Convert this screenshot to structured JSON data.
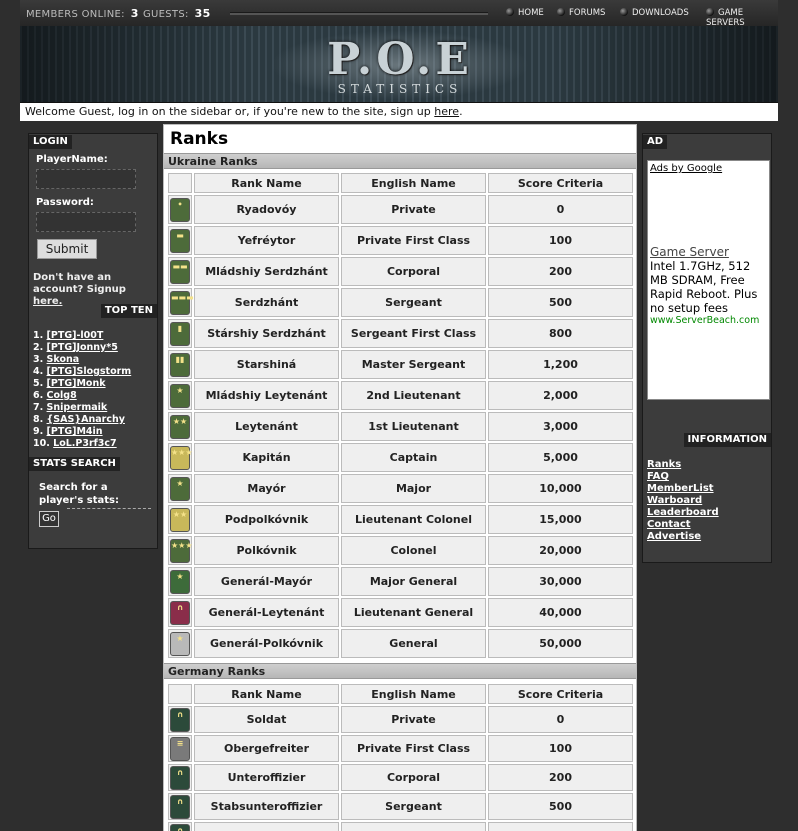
{
  "topbar": {
    "members_label": "MEMBERS ONLINE:",
    "members_count": "3",
    "guests_label": "GUESTS:",
    "guests_count": "35",
    "nav": [
      "HOME",
      "FORUMS",
      "DOWNLOADS",
      "GAME SERVERS"
    ]
  },
  "banner": {
    "logo": "P.O.E",
    "sub": "STATISTICS"
  },
  "welcome": {
    "text": "Welcome Guest, log in on the sidebar or, if you're new to the site, sign up ",
    "link": "here",
    "end": "."
  },
  "login": {
    "heading": "LOGIN",
    "player_label": "PlayerName:",
    "password_label": "Password:",
    "submit": "Submit",
    "note": "Don't have an account? Signup ",
    "note_link": "here."
  },
  "topten": {
    "heading": "TOP TEN",
    "items": [
      {
        "n": "1.",
        "name": "[PTG]-l00T"
      },
      {
        "n": "2.",
        "name": "[PTG]Jonny*5"
      },
      {
        "n": "3.",
        "name": "Skona"
      },
      {
        "n": "4.",
        "name": "[PTG]Slogstorm"
      },
      {
        "n": "5.",
        "name": "[PTG]Monk"
      },
      {
        "n": "6.",
        "name": "Colg8"
      },
      {
        "n": "7.",
        "name": "Snipermaik"
      },
      {
        "n": "8.",
        "name": "{SAS}Anarchy"
      },
      {
        "n": "9.",
        "name": "[PTG]M4in"
      },
      {
        "n": "10.",
        "name": "LoL.P3rf3c7"
      }
    ]
  },
  "stats_search": {
    "heading": "STATS SEARCH",
    "text": "Search for a player's stats:",
    "go": "Go"
  },
  "ad": {
    "heading": "AD",
    "adsby": "Ads by Google",
    "title": "Game Server",
    "text": "Intel 1.7GHz, 512 MB SDRAM, Free Rapid Reboot. Plus no setup fees",
    "url": "www.ServerBeach.com"
  },
  "information": {
    "heading": "INFORMATION",
    "links": [
      "Ranks",
      "FAQ",
      "MemberList",
      "Warboard",
      "Leaderboard",
      "Contact",
      "Advertise"
    ]
  },
  "main": {
    "title": "Ranks",
    "columns": [
      "",
      "Rank Name",
      "English Name",
      "Score Criteria"
    ],
    "ukraine": {
      "heading": "Ukraine Ranks",
      "rows": [
        {
          "rank": "Ryadovóy",
          "english": "Private",
          "score": "0",
          "color": "#4d6b3a",
          "mark": "•"
        },
        {
          "rank": "Yefréytor",
          "english": "Private First Class",
          "score": "100",
          "color": "#4d6b3a",
          "mark": "▬"
        },
        {
          "rank": "Mládshiy Serdzhánt",
          "english": "Corporal",
          "score": "200",
          "color": "#4d6b3a",
          "mark": "▬▬"
        },
        {
          "rank": "Serdzhánt",
          "english": "Sergeant",
          "score": "500",
          "color": "#4d6b3a",
          "mark": "▬▬▬"
        },
        {
          "rank": "Stárshiy Serdzhánt",
          "english": "Sergeant First Class",
          "score": "800",
          "color": "#4d6b3a",
          "mark": "▮"
        },
        {
          "rank": "Starshiná",
          "english": "Master Sergeant",
          "score": "1,200",
          "color": "#4d6b3a",
          "mark": "▮▮"
        },
        {
          "rank": "Mládshiy Leytenánt",
          "english": "2nd Lieutenant",
          "score": "2,000",
          "color": "#4d6b3a",
          "mark": "★"
        },
        {
          "rank": "Leytenánt",
          "english": "1st Lieutenant",
          "score": "3,000",
          "color": "#4d6b3a",
          "mark": "★★"
        },
        {
          "rank": "Kapitán",
          "english": "Captain",
          "score": "5,000",
          "color": "#c8b85a",
          "mark": "★★★"
        },
        {
          "rank": "Mayór",
          "english": "Major",
          "score": "10,000",
          "color": "#4d6b3a",
          "mark": "★"
        },
        {
          "rank": "Podpolkóvnik",
          "english": "Lieutenant Colonel",
          "score": "15,000",
          "color": "#c8b85a",
          "mark": "★★"
        },
        {
          "rank": "Polkóvnik",
          "english": "Colonel",
          "score": "20,000",
          "color": "#4d6b3a",
          "mark": "★★★"
        },
        {
          "rank": "Generál-Mayór",
          "english": "Major General",
          "score": "30,000",
          "color": "#3d6b3a",
          "mark": "★"
        },
        {
          "rank": "Generál-Leytenánt",
          "english": "Lieutenant General",
          "score": "40,000",
          "color": "#8a2d4a",
          "mark": "∩"
        },
        {
          "rank": "Generál-Polkóvnik",
          "english": "General",
          "score": "50,000",
          "color": "#b9b9b9",
          "mark": "★"
        }
      ]
    },
    "germany": {
      "heading": "Germany Ranks",
      "rows": [
        {
          "rank": "Soldat",
          "english": "Private",
          "score": "0",
          "color": "#2c4a3a",
          "mark": "∩"
        },
        {
          "rank": "Obergefreiter",
          "english": "Private First Class",
          "score": "100",
          "color": "#7a7a7a",
          "mark": "≡"
        },
        {
          "rank": "Unteroffizier",
          "english": "Corporal",
          "score": "200",
          "color": "#2c4a3a",
          "mark": "∩"
        },
        {
          "rank": "Stabsunteroffizier",
          "english": "Sergeant",
          "score": "500",
          "color": "#2c4a3a",
          "mark": "∩"
        },
        {
          "rank": "",
          "english": "",
          "score": "",
          "color": "#2c4a3a",
          "mark": "∩"
        }
      ]
    }
  }
}
